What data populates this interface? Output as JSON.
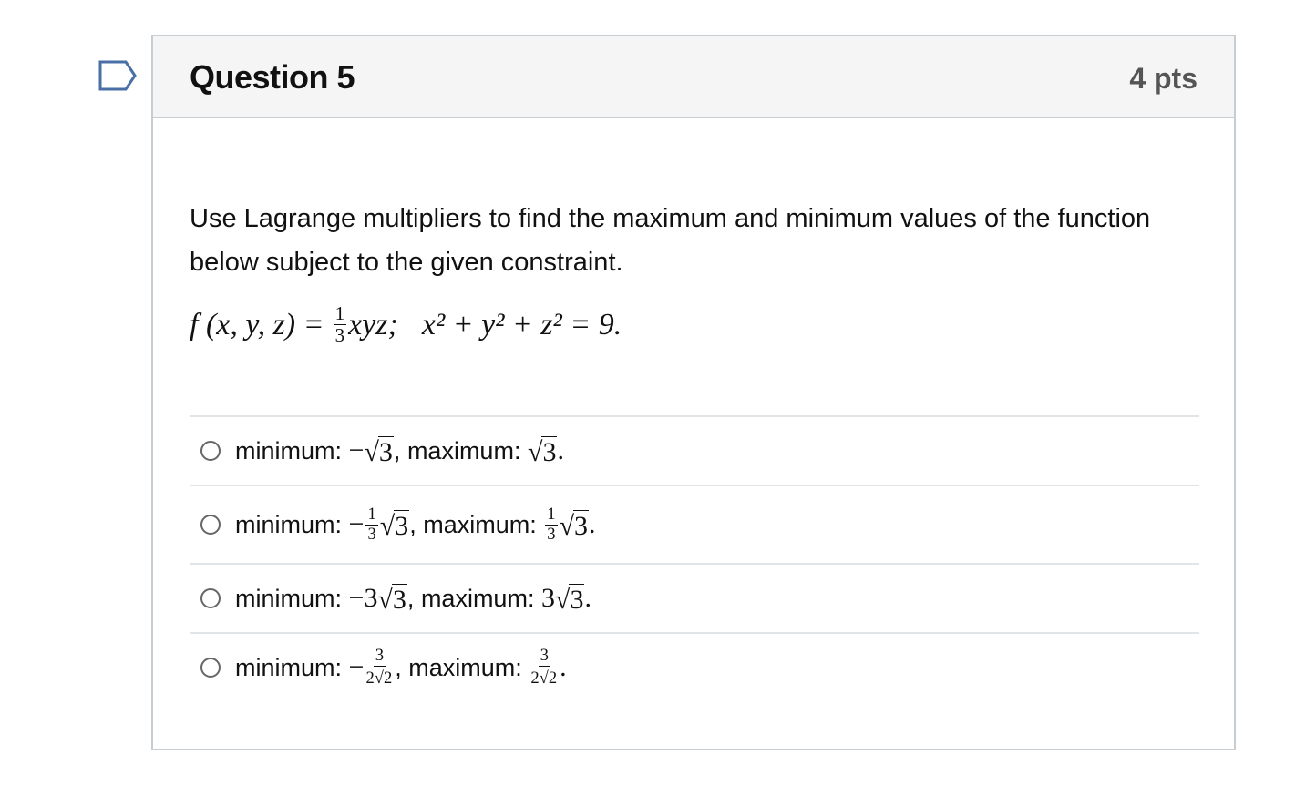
{
  "flag": {
    "icon": "bookmark-flag-icon",
    "color": "#4a6fa5"
  },
  "question": {
    "title": "Question 5",
    "points": "4 pts",
    "prompt": "Use Lagrange multipliers to find the maximum and minimum values of the function below subject to the given constraint.",
    "formula": {
      "lhs": "f (x, y, z) =",
      "frac_num": "1",
      "frac_den": "3",
      "expr": "xyz;",
      "constraint": "x² + y² + z² = 9."
    }
  },
  "answers": [
    {
      "min_label": "minimum:",
      "max_label": "maximum:",
      "min_value": "−√3",
      "max_value": "√3"
    },
    {
      "min_label": "minimum:",
      "max_label": "maximum:",
      "min_value": "−(1/3)√3",
      "max_value": "(1/3)√3"
    },
    {
      "min_label": "minimum:",
      "max_label": "maximum:",
      "min_value": "−3√3",
      "max_value": "3√3"
    },
    {
      "min_label": "minimum:",
      "max_label": "maximum:",
      "min_value": "−3/(2√2)",
      "max_value": "3/(2√2)"
    }
  ]
}
